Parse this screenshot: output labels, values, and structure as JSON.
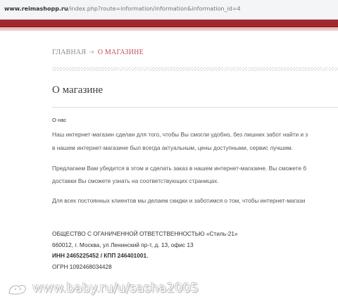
{
  "browser": {
    "url_domain": "www.reimashopp.ru",
    "url_path": "/index.php?route=information/information&information_id=4"
  },
  "breadcrumb": {
    "home": "ГЛАВНАЯ",
    "separator": "➜",
    "current": "О МАГАЗИНЕ"
  },
  "page": {
    "title": "О магазине",
    "section_label": "О нас",
    "para1_line1": "Наш интернет-магазин сделан для того, чтобы Вы смогли удобно, без лишних забот найти и з",
    "para1_line2": "в нашем интернет-магазине был всегда актуальным, цены доступными, сервис лучшим.",
    "para2_line1": "Предлагаем Вам убедится в этом и сделать заказ в нашем интернет-магазине. Вы сможете б",
    "para2_line2": "доставки Вы сможете узнать на соответствующих страницах.",
    "para3_line1": "Для всех постоянных клиентов мы делаем скидки и заботимся о том, чтобы интернет-магази"
  },
  "company": {
    "name": "ОБЩЕСТВО С ОГАНИЧЕННОЙ ОТВЕТСТВЕННОСТЬЮ «Стиль-21»",
    "address": "660012, г. Москва, ул Ленинский пр-т, д. 13, офис 13",
    "inn_kpp": "ИНН 2465225452 / КПП 246401001",
    "inn_kpp_suffix": ",",
    "ogrn": "ОГРН 1092468034428"
  },
  "watermark": {
    "text": "www.baby.ru/u/sasha2005"
  },
  "colors": {
    "accent_red": "#a3262e",
    "breadcrumb_current": "#c0505a"
  }
}
